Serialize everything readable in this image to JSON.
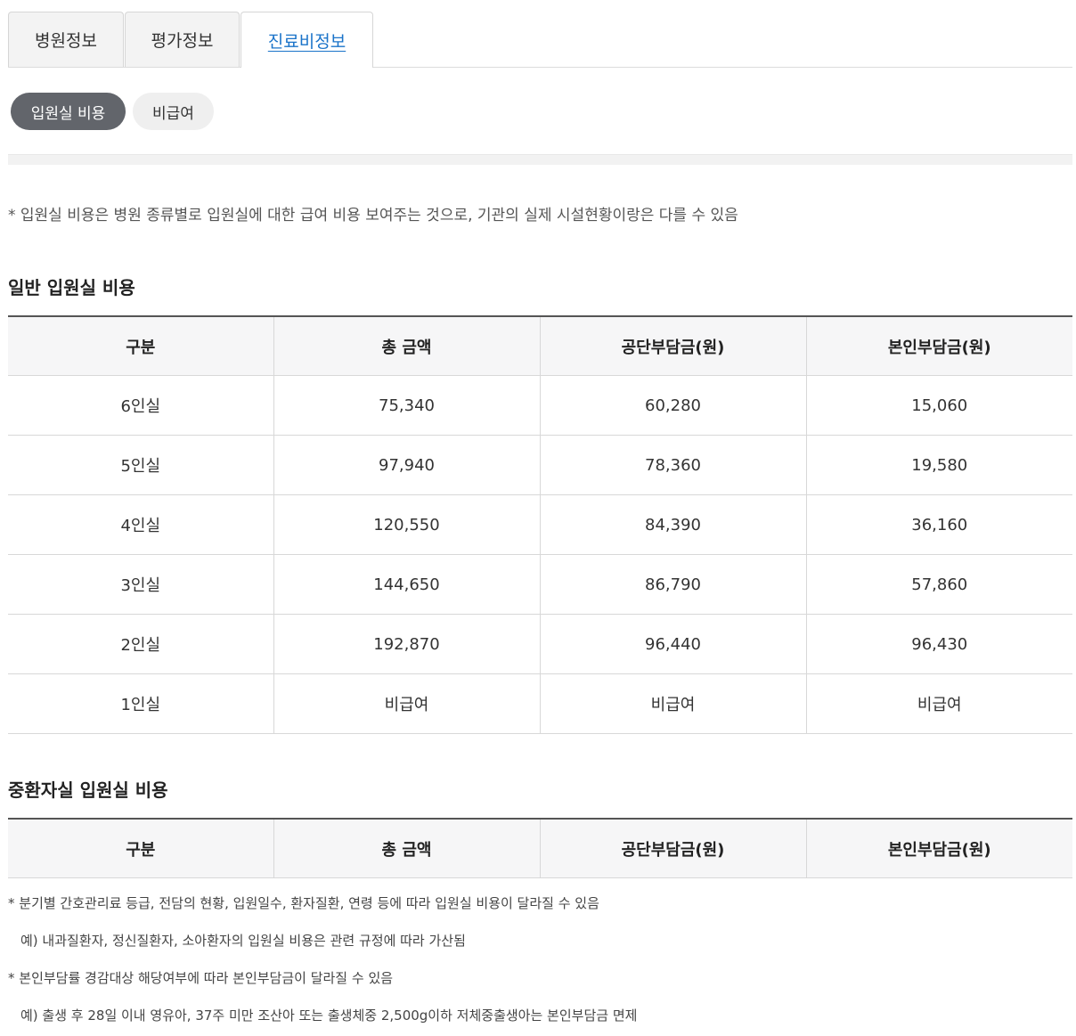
{
  "tabs": [
    {
      "label": "병원정보",
      "active": false
    },
    {
      "label": "평가정보",
      "active": false
    },
    {
      "label": "진료비정보",
      "active": true
    }
  ],
  "pills": [
    {
      "label": "입원실 비용",
      "active": true
    },
    {
      "label": "비급여",
      "active": false
    }
  ],
  "notice": "* 입원실 비용은 병원 종류별로 입원실에 대한 급여 비용 보여주는 것으로, 기관의 실제 시설현황이랑은 다를 수 있음",
  "general": {
    "title": "일반 입원실 비용",
    "headers": [
      "구분",
      "총 금액",
      "공단부담금(원)",
      "본인부담금(원)"
    ],
    "rows": [
      [
        "6인실",
        "75,340",
        "60,280",
        "15,060"
      ],
      [
        "5인실",
        "97,940",
        "78,360",
        "19,580"
      ],
      [
        "4인실",
        "120,550",
        "84,390",
        "36,160"
      ],
      [
        "3인실",
        "144,650",
        "86,790",
        "57,860"
      ],
      [
        "2인실",
        "192,870",
        "96,440",
        "96,430"
      ],
      [
        "1인실",
        "비급여",
        "비급여",
        "비급여"
      ]
    ]
  },
  "icu": {
    "title": "중환자실 입원실 비용",
    "headers": [
      "구분",
      "총 금액",
      "공단부담금(원)",
      "본인부담금(원)"
    ]
  },
  "notes": [
    "* 분기별 간호관리료 등급, 전담의 현황, 입원일수, 환자질환, 연령 등에 따라 입원실 비용이 달라질 수 있음",
    "예) 내과질환자, 정신질환자, 소아환자의 입원실 비용은 관련 규정에 따라 가산됨",
    "* 본인부담률 경감대상 해당여부에 따라 본인부담금이 달라질 수 있음",
    "예) 출생 후 28일 이내 영유아, 37주 미만 조산아 또는 출생체중 2,500g이하 저체중출생아는 본인부담금 면제"
  ]
}
